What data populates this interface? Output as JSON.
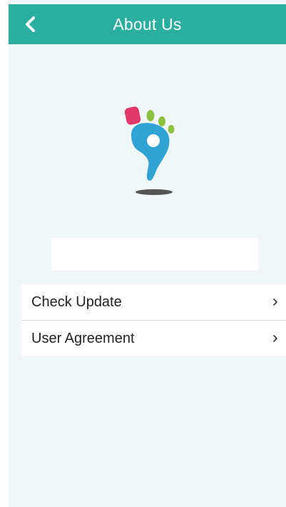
{
  "header": {
    "title": "About Us",
    "back_icon": "chevron-left-icon",
    "color": "#2aaea0"
  },
  "logo": {
    "icon": "footprint-logo",
    "colors": {
      "foot": "#2fa3d4",
      "big_toe": "#e0386a",
      "small_toes": "#8cc23f",
      "shadow": "#555555"
    }
  },
  "menu": {
    "items": [
      {
        "label": "Check Update",
        "icon": "chevron-right-icon"
      },
      {
        "label": "User Agreement",
        "icon": "chevron-right-icon"
      }
    ]
  }
}
